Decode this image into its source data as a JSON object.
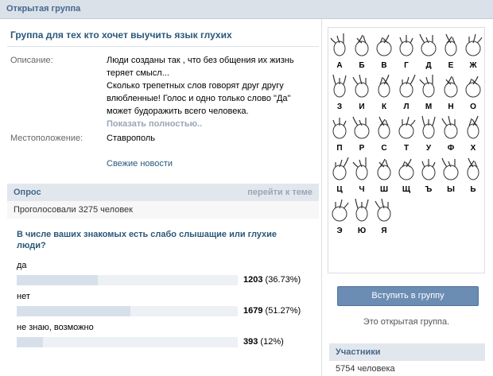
{
  "header": {
    "title": "Открытая группа"
  },
  "group": {
    "title": "Группа для тех кто хочет выучить язык глухих"
  },
  "info": {
    "description_label": "Описание:",
    "description": "Люди созданы так , что без общения их жизнь\nтеряет смысл...\nСколько трепетных слов говорят друг другу\nвлюбленные! Голос и одно только слово \"Да\"\nможет будоражить всего человека.",
    "show_full": "Показать полностью..",
    "location_label": "Местоположение:",
    "location": "Ставрополь",
    "news_link": "Свежие новости"
  },
  "poll": {
    "header": "Опрос",
    "goto_link": "перейти к теме",
    "voted": "Проголосовали 3275 человек",
    "question": "В числе ваших знакомых есть слабо слышащие или глухие люди?",
    "options": [
      {
        "label": "да",
        "votes": "1203",
        "percent_text": "(36.73%)",
        "percent": 36.73
      },
      {
        "label": "нет",
        "votes": "1679",
        "percent_text": "(51.27%)",
        "percent": 51.27
      },
      {
        "label": "не знаю, возможно",
        "votes": "393",
        "percent_text": "(12%)",
        "percent": 12
      }
    ]
  },
  "sidebar": {
    "alphabet_letters": [
      "А",
      "Б",
      "В",
      "Г",
      "Д",
      "Е",
      "Ж",
      "З",
      "И",
      "К",
      "Л",
      "М",
      "Н",
      "О",
      "П",
      "Р",
      "С",
      "Т",
      "У",
      "Ф",
      "Х",
      "Ц",
      "Ч",
      "Ш",
      "Щ",
      "Ъ",
      "Ы",
      "Ь",
      "Э",
      "Ю",
      "Я"
    ],
    "join_button": "Вступить в группу",
    "open_note": "Это открытая группа.",
    "members_header": "Участники",
    "members_count": "5754 человека"
  }
}
